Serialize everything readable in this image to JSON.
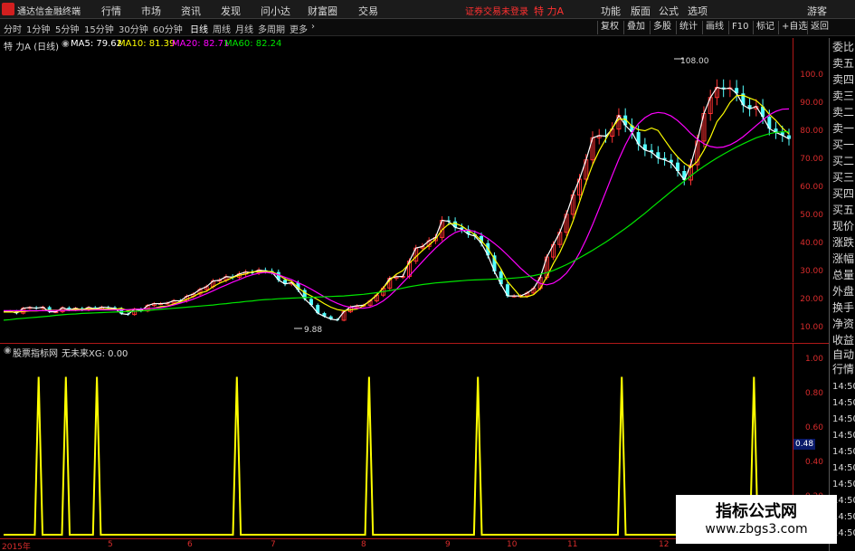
{
  "app": {
    "title": "通达信金融终端"
  },
  "menu": [
    "行情",
    "市场",
    "资讯",
    "发现",
    "问小达",
    "财富圈",
    "交易"
  ],
  "notice": "证券交易未登录",
  "stock_name": "特 力A",
  "right_menu": [
    "功能",
    "版面",
    "公式",
    "选项",
    "游客"
  ],
  "periods": [
    "分时",
    "1分钟",
    "5分钟",
    "15分钟",
    "30分钟",
    "60分钟",
    "日线",
    "周线",
    "月线",
    "多周期",
    "更多"
  ],
  "active_period": "日线",
  "tools": [
    "复权",
    "叠加",
    "多股",
    "统计",
    "画线",
    "F10",
    "标记",
    "+自选",
    "返回"
  ],
  "price_header": {
    "name": "特 力A (日线)",
    "ma5": "MA5: 79.62",
    "ma10": "MA10: 81.39",
    "ma20": "MA20: 82.71",
    "ma60": "MA60: 82.24"
  },
  "price_axis": [
    "100.0",
    "90.00",
    "80.00",
    "70.00",
    "60.00",
    "50.00",
    "40.00",
    "30.00",
    "20.00",
    "10.00"
  ],
  "annotations": {
    "high": "108.00",
    "low": "9.88"
  },
  "indicator_header": {
    "name": "股票指标网",
    "formula": "无未来XG: 0.00"
  },
  "indicator_axis": [
    "1.00",
    "0.80",
    "0.60",
    "0.40",
    "0.20"
  ],
  "indicator_current": "0.48",
  "x_axis": [
    "2015年",
    "5",
    "6",
    "7",
    "8",
    "9",
    "10",
    "11",
    "12"
  ],
  "side_panel": [
    "委比",
    "卖五",
    "卖四",
    "卖三",
    "卖二",
    "卖一",
    "买一",
    "买二",
    "买三",
    "买四",
    "买五",
    "现价",
    "涨跌",
    "涨幅",
    "总量",
    "外盘",
    "换手",
    "净资",
    "收益"
  ],
  "side_panel_lower": [
    "自动",
    "行情"
  ],
  "side_times": [
    "14:50",
    "14:50",
    "14:50",
    "14:50",
    "14:50",
    "14:50",
    "14:50",
    "14:50",
    "14:50",
    "14:50"
  ],
  "watermark": {
    "title": "指标公式网",
    "url": "www.zbgs3.com"
  },
  "colors": {
    "up": "#ff3232",
    "down": "#54ffff",
    "ma5": "#ffffff",
    "ma10": "#ffff00",
    "ma20": "#ff00ff",
    "ma60": "#00e600",
    "signal": "#ffff00",
    "axis": "#b01818"
  },
  "chart_data": [
    {
      "type": "candlestick",
      "series": [
        {
          "name": "MA5",
          "values": [
            16.3,
            16.3,
            15.6,
            17.4,
            17.7,
            17.4,
            17.8,
            16.1,
            16.1,
            17.6,
            16.8,
            17.4,
            16.8,
            17.7,
            17.2,
            17.8,
            17.7,
            17.3,
            15.4,
            15.1,
            17.1,
            16.4,
            18.4,
            19.1,
            19.1,
            19.3,
            20.2,
            20.1,
            21.8,
            22.6,
            24.3,
            25.3,
            27.4,
            27.7,
            29.0,
            28.8,
            30.0,
            30.7,
            30.5,
            31.4,
            31.1,
            30.7,
            27.8,
            26.3,
            26.8,
            24.1,
            20.8,
            18.6,
            15.6,
            14.4,
            13.4,
            13.0,
            16.1,
            17.9,
            18.3,
            18.5,
            20.1,
            22.2,
            24.8,
            28.4,
            29.0,
            29.1,
            34.7,
            39.5,
            40.1,
            42.2,
            43.4,
            49.7,
            49.3,
            47.1,
            46.4,
            44.6,
            43.9,
            41.3,
            36.8,
            30.9,
            26.2,
            21.9,
            21.9,
            21.9,
            23.0,
            24.7,
            28.7,
            36.2,
            40.8,
            45.3,
            51.9,
            59.0,
            64.8,
            71.9,
            80.0,
            80.8,
            80.6,
            83.2,
            88.2,
            84.6,
            82.1,
            77.6,
            75.5,
            74.7,
            72.6,
            71.9,
            70.9,
            67.8,
            64.5,
            70.1,
            78.8,
            88.9,
            94.8,
            98.5,
            97.9,
            98.3,
            96.3,
            92.0,
            90.6,
            91.5,
            87.7,
            83.4,
            82.0,
            80.9,
            79.6
          ]
        },
        {
          "name": "MA10",
          "values": [
            16.0,
            16.0,
            16.0,
            16.2,
            16.4,
            16.4,
            16.6,
            16.7,
            16.7,
            16.7,
            16.7,
            17.0,
            16.9,
            17.1,
            17.1,
            17.0,
            17.2,
            17.0,
            17.4,
            16.5,
            17.1,
            17.0,
            17.2,
            17.4,
            18.0,
            18.2,
            19.0,
            19.8,
            20.7,
            21.7,
            23.0,
            23.6,
            25.3,
            26.6,
            27.6,
            28.7,
            29.5,
            30.0,
            30.8,
            30.8,
            31.0,
            30.8,
            29.7,
            28.1,
            27.3,
            24.9,
            23.1,
            21.9,
            20.6,
            19.1,
            17.8,
            16.9,
            16.5,
            16.8,
            17.1,
            18.3,
            20.2,
            22.3,
            24.8,
            27.7,
            29.9,
            31.2,
            33.9,
            36.3,
            38.6,
            40.6,
            42.8,
            46.2,
            48.3,
            48.6,
            47.6,
            45.9,
            44.5,
            42.2,
            39.4,
            35.5,
            31.8,
            27.2,
            24.4,
            21.6,
            21.6,
            22.4,
            24.6,
            29.0,
            33.8,
            37.9,
            43.3,
            49.4,
            56.4,
            63.7,
            70.1,
            75.2,
            79.5,
            83.6,
            86.9,
            86.8,
            84.3,
            83.0,
            82.6,
            83.6,
            82.7,
            79.2,
            75.8,
            73.0,
            70.7,
            69.1,
            71.3,
            75.4,
            80.2,
            85.9,
            89.0,
            93.0,
            95.5,
            95.6,
            94.6,
            93.7,
            91.5,
            88.6,
            86.4,
            83.6,
            81.4
          ]
        },
        {
          "name": "MA20",
          "values": [
            16.5,
            16.5,
            16.5,
            16.5,
            16.5,
            16.5,
            16.5,
            16.5,
            16.6,
            16.6,
            16.6,
            16.6,
            16.7,
            16.7,
            16.8,
            16.8,
            16.8,
            16.8,
            16.8,
            16.9,
            17.0,
            17.1,
            17.2,
            17.4,
            17.6,
            18.0,
            18.6,
            19.3,
            20.0,
            20.8,
            21.7,
            22.7,
            23.8,
            24.9,
            25.9,
            27.0,
            27.9,
            28.9,
            29.7,
            30.3,
            30.6,
            30.3,
            29.7,
            28.8,
            27.9,
            26.8,
            25.7,
            24.4,
            23.0,
            21.6,
            20.3,
            19.2,
            18.3,
            17.7,
            17.4,
            17.4,
            17.8,
            18.7,
            20.1,
            22.0,
            24.3,
            26.8,
            29.3,
            31.9,
            34.5,
            37.1,
            39.5,
            41.7,
            43.7,
            45.2,
            46.0,
            46.1,
            45.6,
            44.5,
            43.0,
            41.2,
            39.2,
            36.9,
            34.5,
            32.1,
            30.0,
            28.0,
            26.5,
            26.0,
            26.6,
            28.1,
            30.3,
            33.5,
            37.7,
            42.6,
            48.1,
            54.0,
            60.1,
            66.2,
            72.1,
            77.4,
            81.9,
            85.2,
            87.4,
            88.8,
            89.3,
            89.0,
            88.0,
            86.3,
            84.1,
            81.6,
            79.5,
            77.8,
            76.8,
            76.4,
            76.6,
            77.4,
            78.7,
            80.4,
            82.4,
            84.5,
            86.5,
            88.4,
            89.7,
            90.5,
            90.6
          ]
        },
        {
          "name": "MA60",
          "values": [
            13.0,
            13.2,
            13.5,
            13.7,
            13.9,
            14.1,
            14.3,
            14.5,
            14.8,
            15.0,
            15.2,
            15.3,
            15.5,
            15.6,
            15.7,
            15.8,
            15.9,
            16.0,
            16.1,
            16.2,
            16.3,
            16.4,
            16.6,
            16.8,
            17.0,
            17.2,
            17.4,
            17.6,
            17.8,
            18.0,
            18.2,
            18.4,
            18.6,
            18.9,
            19.1,
            19.4,
            19.6,
            19.9,
            20.1,
            20.4,
            20.6,
            20.7,
            20.9,
            21.0,
            21.1,
            21.2,
            21.3,
            21.4,
            21.5,
            21.6,
            21.7,
            21.8,
            21.9,
            22.1,
            22.3,
            22.5,
            22.8,
            23.1,
            23.5,
            23.9,
            24.3,
            24.8,
            25.3,
            25.7,
            26.1,
            26.4,
            26.7,
            26.9,
            27.1,
            27.3,
            27.5,
            27.7,
            27.8,
            27.9,
            28.0,
            28.1,
            28.2,
            28.3,
            28.5,
            28.7,
            29.0,
            29.4,
            29.9,
            30.5,
            31.3,
            32.3,
            33.4,
            34.6,
            35.9,
            37.3,
            38.7,
            40.2,
            41.7,
            43.3,
            45.0,
            46.7,
            48.5,
            50.4,
            52.3,
            54.3,
            56.3,
            58.3,
            60.3,
            62.2,
            64.1,
            66.0,
            67.8,
            69.5,
            71.1,
            72.6,
            74.0,
            75.3,
            76.6,
            77.8,
            78.9,
            80.0,
            80.8,
            81.5,
            82.0,
            82.2,
            82.2
          ]
        }
      ],
      "ylim": [
        5,
        112
      ]
    },
    {
      "type": "line",
      "series": [
        {
          "name": "XG",
          "values": [
            0,
            0,
            0,
            0,
            0,
            0,
            0,
            0,
            0,
            1,
            0,
            0,
            0,
            0,
            0,
            0,
            1,
            0,
            0,
            0,
            0,
            0,
            0,
            0,
            1,
            0,
            0,
            0,
            0,
            0,
            0,
            0,
            0,
            0,
            0,
            0,
            0,
            0,
            0,
            0,
            0,
            0,
            0,
            0,
            0,
            0,
            0,
            0,
            0,
            0,
            0,
            0,
            0,
            0,
            0,
            0,
            0,
            0,
            0,
            0,
            1,
            0,
            0,
            0,
            0,
            0,
            0,
            0,
            0,
            0,
            0,
            0,
            0,
            0,
            0,
            0,
            0,
            0,
            0,
            0,
            0,
            0,
            0,
            0,
            0,
            0,
            0,
            0,
            0,
            0,
            0,
            0,
            0,
            0,
            1,
            0,
            0,
            0,
            0,
            0,
            0,
            0,
            0,
            0,
            0,
            0,
            0,
            0,
            0,
            0,
            0,
            0,
            0,
            0,
            0,
            0,
            0,
            0,
            0,
            0,
            0,
            0,
            1,
            0,
            0,
            0,
            0,
            0,
            0,
            0,
            0,
            0,
            0,
            0,
            0,
            0,
            0,
            0,
            0,
            0,
            0,
            0,
            0,
            0,
            0,
            0,
            0,
            0,
            0,
            0,
            0,
            0,
            0,
            0,
            0,
            0,
            0,
            0,
            0,
            1,
            0,
            0,
            0,
            0,
            0,
            0,
            0,
            0,
            0,
            0,
            0,
            0,
            0,
            0,
            0,
            0,
            0,
            0,
            0,
            0,
            0,
            0,
            0,
            0,
            0,
            0,
            0,
            0,
            0,
            0,
            0,
            0,
            0,
            1,
            0,
            0,
            0,
            0,
            0,
            0,
            0,
            0,
            0
          ]
        }
      ],
      "ylim": [
        0,
        1.1
      ]
    }
  ]
}
